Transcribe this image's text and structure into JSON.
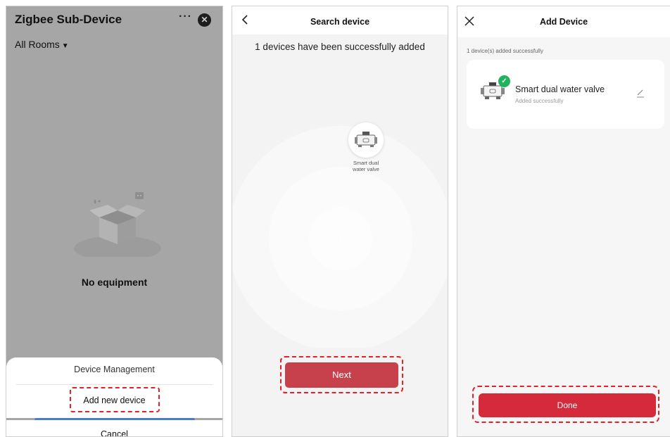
{
  "panel1": {
    "title": "Zigbee Sub-Device",
    "more_icon": "more-icon",
    "more_glyph": "···",
    "close_icon": "close-circle-icon",
    "close_glyph": "✕",
    "rooms_filter": "All Rooms",
    "caret_glyph": "▼",
    "empty_illustration": "empty-box-icon",
    "empty_text": "No equipment",
    "sheet": {
      "title": "Device Management",
      "add_label": "Add new device",
      "cancel_label": "Cancel"
    }
  },
  "panel2": {
    "title": "Search device",
    "back_icon": "chevron-left-icon",
    "status": "1 devices have been successfully added",
    "device_icon": "water-valve-icon",
    "device_label_line1": "Smart dual",
    "device_label_line2": "water valve",
    "next_label": "Next"
  },
  "panel3": {
    "title": "Add Device",
    "close_icon": "close-icon",
    "count_text": "1 device(s) added successfully",
    "device": {
      "name": "Smart dual water valve",
      "status": "Added successfully",
      "icon": "water-valve-icon",
      "check_icon": "check-badge-icon",
      "check_glyph": "✓",
      "edit_icon": "pencil-icon"
    },
    "done_label": "Done"
  },
  "colors": {
    "overlay_gray": "#a6a6a6",
    "accent_red": "#d42a3c",
    "next_red": "#c6414b",
    "highlight_dash": "#e0222b",
    "success_green": "#1fb35f",
    "sheet_blue": "#4a7cc7"
  }
}
